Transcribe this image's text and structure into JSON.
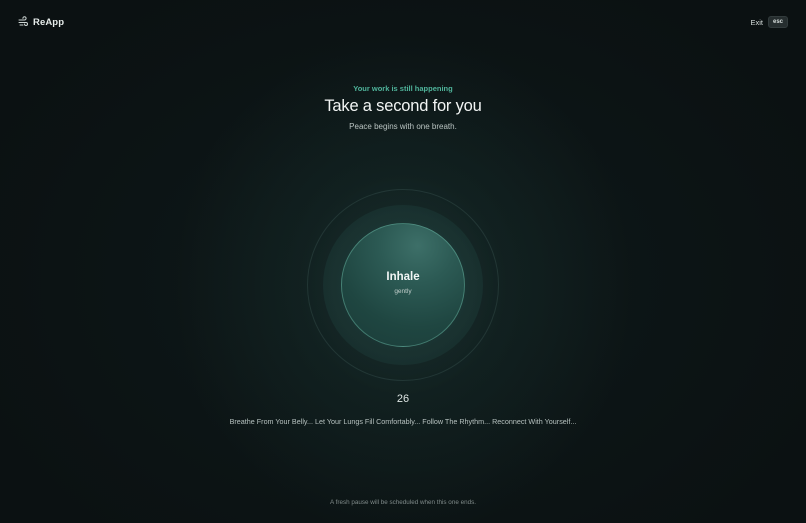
{
  "app": {
    "brand_icon": "wind-icon",
    "name": "ReApp"
  },
  "header": {
    "exit_label": "Exit",
    "exit_shortcut": "esc"
  },
  "intro": {
    "eyebrow": "Your work is still happening",
    "title": "Take a second for you",
    "subtitle": "Peace begins with one breath."
  },
  "breathing": {
    "phase": "Inhale",
    "phase_hint": "gently",
    "countdown": "26",
    "guidance": "Breathe From Your Belly... Let Your Lungs Fill Comfortably... Follow The Rhythm... Reconnect With Yourself..."
  },
  "footer": {
    "note": "A fresh pause will be scheduled when this one ends."
  },
  "colors": {
    "background": "#0b1112",
    "accent": "#4fb39a",
    "orb": "#2c5a54"
  }
}
